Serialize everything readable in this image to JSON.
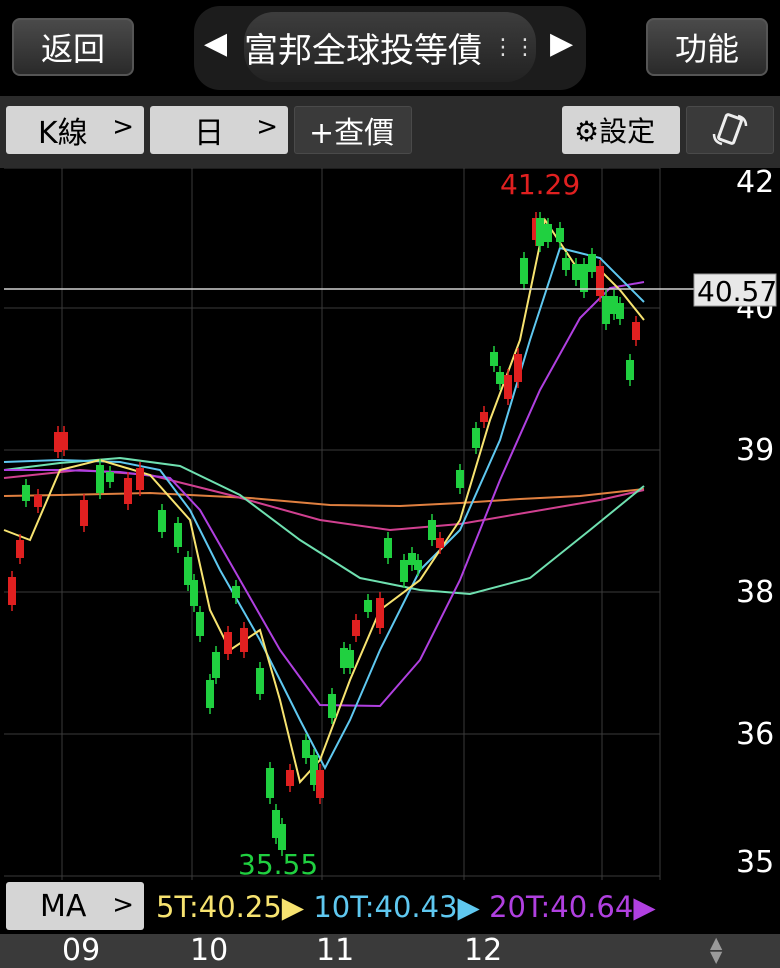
{
  "header": {
    "back_label": "返回",
    "title": "富邦全球投等債",
    "menu_label": "功能"
  },
  "toolbar": {
    "chart_type": "K線",
    "period": "日",
    "add_price": "+查價",
    "settings": "⚙設定"
  },
  "chart": {
    "high_label": "41.29",
    "low_label": "35.55",
    "current_price": "40.57",
    "y_ticks": [
      "42",
      "40",
      "39",
      "38",
      "36",
      "35"
    ],
    "x_ticks": [
      "09",
      "10",
      "11",
      "12"
    ],
    "colors": {
      "up": "#e02020",
      "down": "#20d040",
      "ma5": "#f7e370",
      "ma10": "#5fc8f0",
      "ma20": "#b040e0",
      "ma60": "#6fe0b0",
      "ma120": "#d04090",
      "ma240": "#e08040"
    }
  },
  "ma": {
    "button_label": "MA",
    "ma5": "5T:40.25",
    "ma10": "10T:40.43",
    "ma20": "20T:40.64",
    "ma60_partial": "6"
  },
  "chart_data": {
    "type": "candlestick",
    "title": "富邦全球投等債",
    "y_ticks": [
      42,
      40,
      39,
      38,
      36,
      35
    ],
    "x_ticks": [
      "09",
      "10",
      "11",
      "12"
    ],
    "max_marker": 41.29,
    "min_marker": 35.55,
    "last_price": 40.57,
    "series": [
      {
        "name": "5T",
        "value": 40.25
      },
      {
        "name": "10T",
        "value": 40.43
      },
      {
        "name": "20T",
        "value": 40.64
      }
    ]
  }
}
